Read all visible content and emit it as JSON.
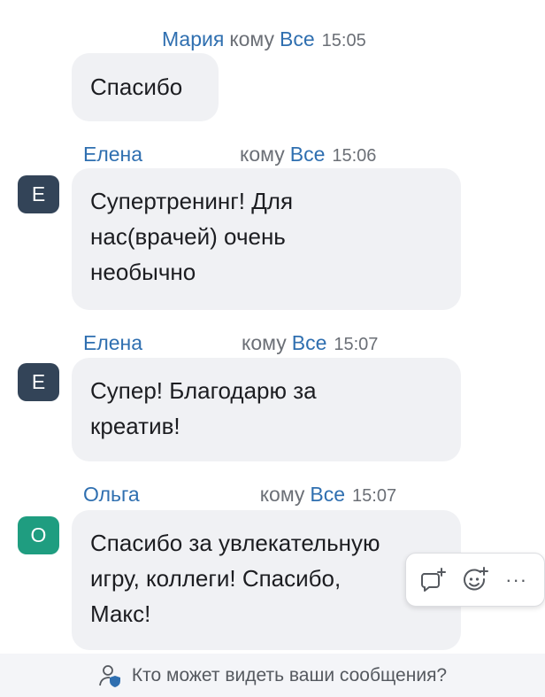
{
  "colors": {
    "accent": "#2f6fb0",
    "avatar_dark": "#334458",
    "avatar_green": "#1f9d80"
  },
  "messages": [
    {
      "sender": "Мария",
      "to": "кому",
      "recipient": "Все",
      "time": "15:05",
      "lines": [
        "Спасибо"
      ]
    },
    {
      "sender": "Елена",
      "to": "кому",
      "recipient": "Все",
      "time": "15:06",
      "avatar": "Е",
      "lines": [
        "Супертренинг! Для",
        "нас(врачей) очень",
        "необычно"
      ]
    },
    {
      "sender": "Елена",
      "to": "кому",
      "recipient": "Все",
      "time": "15:07",
      "avatar": "Е",
      "lines": [
        "Супер! Благодарю за",
        "креатив!"
      ]
    },
    {
      "sender": "Ольга",
      "to": "кому",
      "recipient": "Все",
      "time": "15:07",
      "avatar": "О",
      "lines": [
        "Спасибо за увлекательную",
        "игру, коллеги! Спасибо,",
        "Макс!"
      ]
    }
  ],
  "toolbar": {
    "icons": [
      "comment-add-icon",
      "emoji-add-icon",
      "more-icon"
    ],
    "more_label": "···"
  },
  "footer": {
    "text": "Кто может видеть ваши сообщения?",
    "icon": "person-shield-icon"
  }
}
